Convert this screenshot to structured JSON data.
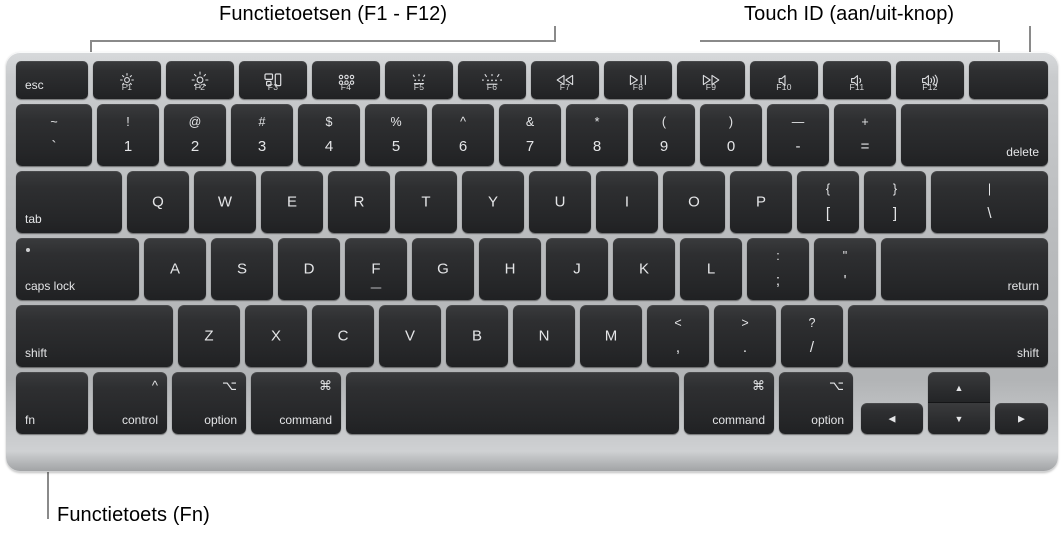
{
  "callouts": {
    "function_keys": "Functietoetsen (F1 - F12)",
    "touch_id": "Touch ID (aan/uit-knop)",
    "fn_key": "Functietoets (Fn)"
  },
  "colors": {
    "chassis": "#b9bbbd",
    "key": "#2a2b2d",
    "key_text": "#e4e5e7",
    "leader_line": "#8a8a8a",
    "callout_text": "#000000"
  },
  "keyboard": {
    "rows": {
      "function_row": [
        {
          "label": "esc",
          "icon": "",
          "fn": ""
        },
        {
          "label": "",
          "icon": "brightness-down-icon",
          "fn": "F1"
        },
        {
          "label": "",
          "icon": "brightness-up-icon",
          "fn": "F2"
        },
        {
          "label": "",
          "icon": "mission-control-icon",
          "fn": "F3"
        },
        {
          "label": "",
          "icon": "spotlight-grid-icon",
          "fn": "F4"
        },
        {
          "label": "",
          "icon": "keyboard-backlight-down-icon",
          "fn": "F5"
        },
        {
          "label": "",
          "icon": "keyboard-backlight-up-icon",
          "fn": "F6"
        },
        {
          "label": "",
          "icon": "rewind-icon",
          "fn": "F7"
        },
        {
          "label": "",
          "icon": "play-pause-icon",
          "fn": "F8"
        },
        {
          "label": "",
          "icon": "fast-forward-icon",
          "fn": "F9"
        },
        {
          "label": "",
          "icon": "volume-mute-icon",
          "fn": "F10"
        },
        {
          "label": "",
          "icon": "volume-down-icon",
          "fn": "F11"
        },
        {
          "label": "",
          "icon": "volume-up-icon",
          "fn": "F12"
        },
        {
          "label": "",
          "icon": "touch-id-icon",
          "fn": ""
        }
      ],
      "number_row": [
        {
          "upper": "~",
          "lower": "`"
        },
        {
          "upper": "!",
          "lower": "1"
        },
        {
          "upper": "@",
          "lower": "2"
        },
        {
          "upper": "#",
          "lower": "3"
        },
        {
          "upper": "$",
          "lower": "4"
        },
        {
          "upper": "%",
          "lower": "5"
        },
        {
          "upper": "^",
          "lower": "6"
        },
        {
          "upper": "&",
          "lower": "7"
        },
        {
          "upper": "*",
          "lower": "8"
        },
        {
          "upper": "(",
          "lower": "9"
        },
        {
          "upper": ")",
          "lower": "0"
        },
        {
          "upper": "—",
          "lower": "-"
        },
        {
          "upper": "+",
          "lower": "="
        },
        {
          "word": "delete"
        }
      ],
      "top_row": [
        {
          "word": "tab"
        },
        {
          "alpha": "Q"
        },
        {
          "alpha": "W"
        },
        {
          "alpha": "E"
        },
        {
          "alpha": "R"
        },
        {
          "alpha": "T"
        },
        {
          "alpha": "Y"
        },
        {
          "alpha": "U"
        },
        {
          "alpha": "I"
        },
        {
          "alpha": "O"
        },
        {
          "alpha": "P"
        },
        {
          "upper": "{",
          "lower": "["
        },
        {
          "upper": "}",
          "lower": "]"
        },
        {
          "upper": "|",
          "lower": "\\"
        }
      ],
      "home_row": [
        {
          "word": "caps lock"
        },
        {
          "alpha": "A"
        },
        {
          "alpha": "S"
        },
        {
          "alpha": "D"
        },
        {
          "alpha": "F"
        },
        {
          "alpha": "G"
        },
        {
          "alpha": "H"
        },
        {
          "alpha": "J"
        },
        {
          "alpha": "K"
        },
        {
          "alpha": "L"
        },
        {
          "upper": ":",
          "lower": ";"
        },
        {
          "upper": "\"",
          "lower": "'"
        },
        {
          "word": "return"
        }
      ],
      "bottom_letter_row": [
        {
          "word": "shift"
        },
        {
          "alpha": "Z"
        },
        {
          "alpha": "X"
        },
        {
          "alpha": "C"
        },
        {
          "alpha": "V"
        },
        {
          "alpha": "B"
        },
        {
          "alpha": "N"
        },
        {
          "alpha": "M"
        },
        {
          "upper": "<",
          "lower": ","
        },
        {
          "upper": ">",
          "lower": "."
        },
        {
          "upper": "?",
          "lower": "/"
        },
        {
          "word": "shift"
        }
      ],
      "modifier_row": [
        {
          "symbol": "",
          "word": "fn"
        },
        {
          "symbol": "^",
          "word": "control"
        },
        {
          "symbol": "⌥",
          "word": "option"
        },
        {
          "symbol": "⌘",
          "word": "command"
        },
        {
          "symbol": "",
          "word": ""
        },
        {
          "symbol": "⌘",
          "word": "command"
        },
        {
          "symbol": "⌥",
          "word": "option"
        }
      ],
      "arrow_keys": {
        "left": "◀",
        "up": "▲",
        "down": "▼",
        "right": "▶"
      }
    }
  }
}
